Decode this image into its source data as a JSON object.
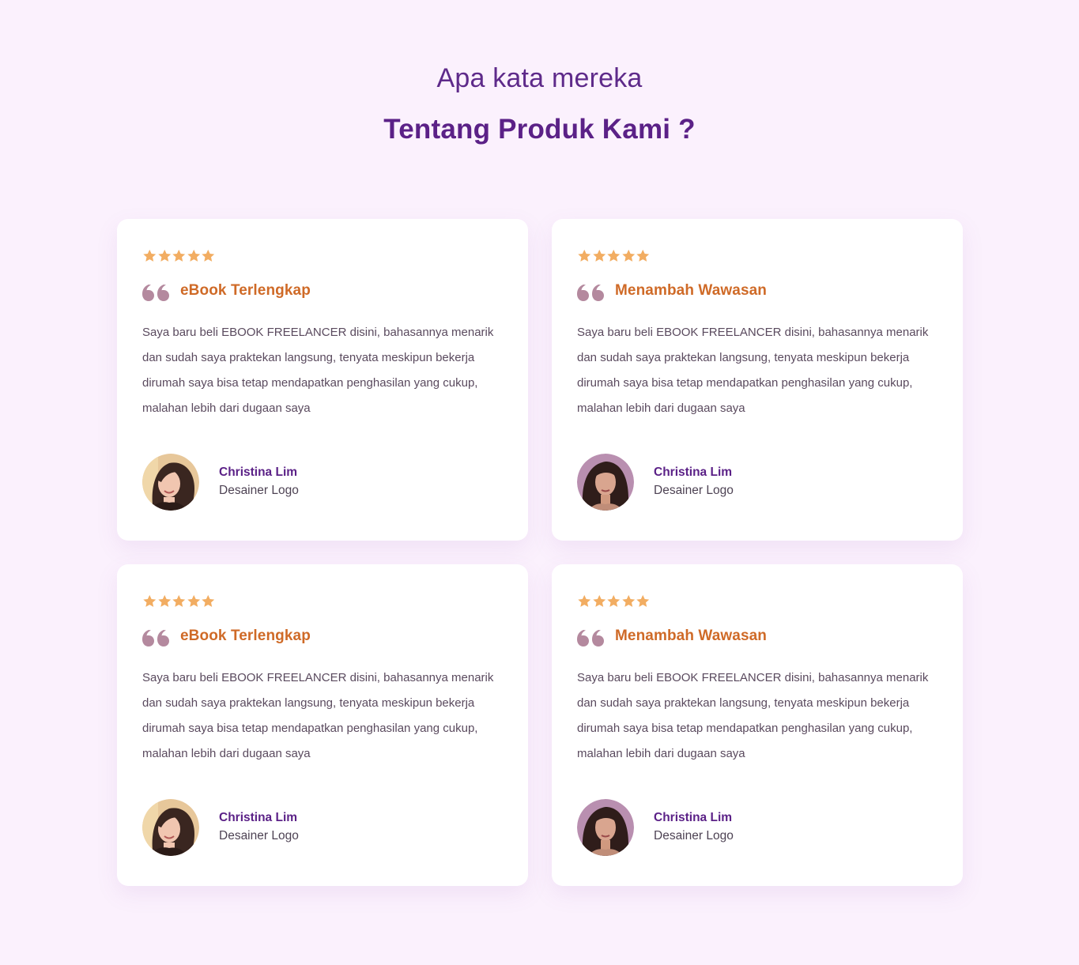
{
  "section": {
    "subtitle": "Apa kata mereka",
    "title": "Tentang Produk Kami ?"
  },
  "colors": {
    "background": "#fbf1fd",
    "heading_purple": "#5b2187",
    "card_title_orange": "#cf6a27",
    "star_gold": "#f2ad62",
    "quote_mauve": "#b4899e"
  },
  "testimonials": [
    {
      "rating": 5,
      "title": "eBook Terlengkap",
      "text": "Saya baru beli EBOOK FREELANCER disini, bahasannya menarik dan sudah saya praktekan langsung, tenyata meskipun bekerja dirumah saya bisa tetap mendapatkan penghasilan yang cukup, malahan lebih dari dugaan saya",
      "author_name": "Christina Lim",
      "author_role": "Desainer Logo",
      "avatar_icon": "avatar-woman-smiling"
    },
    {
      "rating": 5,
      "title": "Menambah Wawasan",
      "text": "Saya baru beli EBOOK FREELANCER disini, bahasannya menarik dan sudah saya praktekan langsung, tenyata meskipun bekerja dirumah saya bisa tetap mendapatkan penghasilan yang cukup, malahan lebih dari dugaan saya",
      "author_name": "Christina Lim",
      "author_role": "Desainer Logo",
      "avatar_icon": "avatar-woman-portrait"
    },
    {
      "rating": 5,
      "title": "eBook Terlengkap",
      "text": "Saya baru beli EBOOK FREELANCER disini, bahasannya menarik dan sudah saya praktekan langsung, tenyata meskipun bekerja dirumah saya bisa tetap mendapatkan penghasilan yang cukup, malahan lebih dari dugaan saya",
      "author_name": "Christina Lim",
      "author_role": "Desainer Logo",
      "avatar_icon": "avatar-woman-smiling"
    },
    {
      "rating": 5,
      "title": "Menambah Wawasan",
      "text": "Saya baru beli EBOOK FREELANCER disini, bahasannya menarik dan sudah saya praktekan langsung, tenyata meskipun bekerja dirumah saya bisa tetap mendapatkan penghasilan yang cukup, malahan lebih dari dugaan saya",
      "author_name": "Christina Lim",
      "author_role": "Desainer Logo",
      "avatar_icon": "avatar-woman-portrait"
    }
  ]
}
